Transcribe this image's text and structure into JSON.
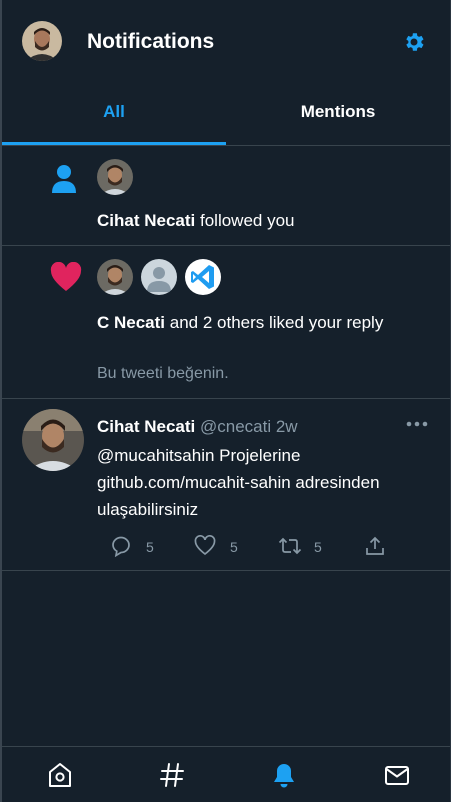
{
  "header": {
    "title": "Notifications",
    "avatar_icon": "user-avatar",
    "settings_icon": "gear-icon",
    "accent": "#1da1f2"
  },
  "tabs": [
    {
      "label": "All",
      "active": true
    },
    {
      "label": "Mentions",
      "active": false
    }
  ],
  "notifications": [
    {
      "type": "follow",
      "icon": "person-icon",
      "user": "Cihat Necati",
      "text": "followed you"
    },
    {
      "type": "like",
      "icon": "heart-icon",
      "user": "C Necati",
      "text": "and 2 others liked your reply",
      "subtext": "Bu tweeti beğenin."
    }
  ],
  "tweet": {
    "name": "Cihat Necati",
    "handle": "@cnecati",
    "time": "2w",
    "body": "@mucahitsahin Projelerine github.com/mucahit-sahin adresinden ulaşabilirsiniz",
    "reply_count": "5",
    "like_count": "5",
    "retweet_count": "5"
  },
  "bottom_nav": [
    {
      "icon": "home-icon",
      "active": false
    },
    {
      "icon": "explore-hashtag-icon",
      "active": false
    },
    {
      "icon": "notifications-bell-icon",
      "active": true
    },
    {
      "icon": "messages-mail-icon",
      "active": false
    }
  ]
}
